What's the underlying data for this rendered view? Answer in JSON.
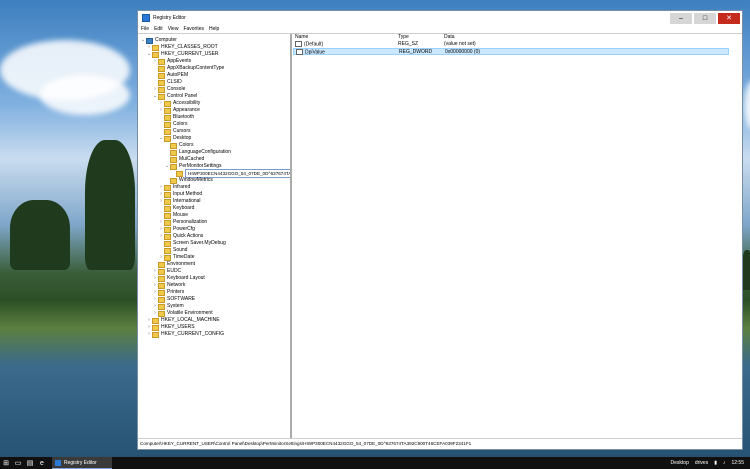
{
  "window": {
    "title": "Registry Editor",
    "controls": [
      "–",
      "□",
      "✕"
    ]
  },
  "menu": [
    "File",
    "Edit",
    "View",
    "Favorites",
    "Help"
  ],
  "tree": [
    {
      "label": "Computer",
      "depth": 0,
      "exp": "v",
      "kind": "pc"
    },
    {
      "label": "HKEY_CLASSES_ROOT",
      "depth": 1,
      "exp": ">"
    },
    {
      "label": "HKEY_CURRENT_USER",
      "depth": 1,
      "exp": "v"
    },
    {
      "label": "AppEvents",
      "depth": 2,
      "exp": ">"
    },
    {
      "label": "AppXBackupContentType",
      "depth": 2,
      "exp": ""
    },
    {
      "label": "AutoPEM",
      "depth": 2,
      "exp": ""
    },
    {
      "label": "CLSID",
      "depth": 2,
      "exp": ""
    },
    {
      "label": "Console",
      "depth": 2,
      "exp": ">"
    },
    {
      "label": "Control Panel",
      "depth": 2,
      "exp": "v"
    },
    {
      "label": "Accessibility",
      "depth": 3,
      "exp": ">"
    },
    {
      "label": "Appearance",
      "depth": 3,
      "exp": ">"
    },
    {
      "label": "Bluetooth",
      "depth": 3,
      "exp": ""
    },
    {
      "label": "Colors",
      "depth": 3,
      "exp": ""
    },
    {
      "label": "Cursors",
      "depth": 3,
      "exp": ""
    },
    {
      "label": "Desktop",
      "depth": 3,
      "exp": "v"
    },
    {
      "label": "Colors",
      "depth": 4,
      "exp": ""
    },
    {
      "label": "LanguageConfiguration",
      "depth": 4,
      "exp": ""
    },
    {
      "label": "MuiCached",
      "depth": 4,
      "exp": ""
    },
    {
      "label": "PerMonitorSettings",
      "depth": 4,
      "exp": "v"
    },
    {
      "label": "HIWP300ECN4432GGO_54_07DE_0D^637674TA392C900T46CEFA039F2341F1",
      "depth": 5,
      "exp": "",
      "edit": true
    },
    {
      "label": "WindowMetrics",
      "depth": 4,
      "exp": ""
    },
    {
      "label": "Infrared",
      "depth": 3,
      "exp": ">"
    },
    {
      "label": "Input Method",
      "depth": 3,
      "exp": ">"
    },
    {
      "label": "International",
      "depth": 3,
      "exp": ">"
    },
    {
      "label": "Keyboard",
      "depth": 3,
      "exp": ""
    },
    {
      "label": "Mouse",
      "depth": 3,
      "exp": ""
    },
    {
      "label": "Personalization",
      "depth": 3,
      "exp": ">"
    },
    {
      "label": "PowerCfg",
      "depth": 3,
      "exp": ">"
    },
    {
      "label": "Quick Actions",
      "depth": 3,
      "exp": ">"
    },
    {
      "label": "Screen Saver.MyDebug",
      "depth": 3,
      "exp": ""
    },
    {
      "label": "Sound",
      "depth": 3,
      "exp": ""
    },
    {
      "label": "TimeDate",
      "depth": 3,
      "exp": ">"
    },
    {
      "label": "Environment",
      "depth": 2,
      "exp": ""
    },
    {
      "label": "EUDC",
      "depth": 2,
      "exp": ">"
    },
    {
      "label": "Keyboard Layout",
      "depth": 2,
      "exp": ">"
    },
    {
      "label": "Network",
      "depth": 2,
      "exp": ">"
    },
    {
      "label": "Printers",
      "depth": 2,
      "exp": ">"
    },
    {
      "label": "SOFTWARE",
      "depth": 2,
      "exp": ">"
    },
    {
      "label": "System",
      "depth": 2,
      "exp": ">"
    },
    {
      "label": "Volatile Environment",
      "depth": 2,
      "exp": ">"
    },
    {
      "label": "HKEY_LOCAL_MACHINE",
      "depth": 1,
      "exp": ">"
    },
    {
      "label": "HKEY_USERS",
      "depth": 1,
      "exp": ">"
    },
    {
      "label": "HKEY_CURRENT_CONFIG",
      "depth": 1,
      "exp": ">"
    }
  ],
  "list": {
    "headers": {
      "name": "Name",
      "type": "Type",
      "data": "Data"
    },
    "rows": [
      {
        "name": "(Default)",
        "type": "REG_SZ",
        "data": "(value not set)",
        "icon": "ab-string-icon",
        "selected": false
      },
      {
        "name": "DpiValue",
        "type": "REG_DWORD",
        "data": "0x00000000 (0)",
        "icon": "binary-value-icon",
        "selected": true
      }
    ]
  },
  "status": "Computer\\HKEY_CURRENT_USER\\Control Panel\\Desktop\\PerMonitorSettings\\HIWP300ECN4432GGO_54_07DE_0D^637674TA392C900T46CEFA039F2341F1",
  "taskbar": {
    "app_label": "Registry Editor",
    "tray": {
      "desktop": "Desktop",
      "drives": "drives",
      "time": "12:55"
    }
  }
}
